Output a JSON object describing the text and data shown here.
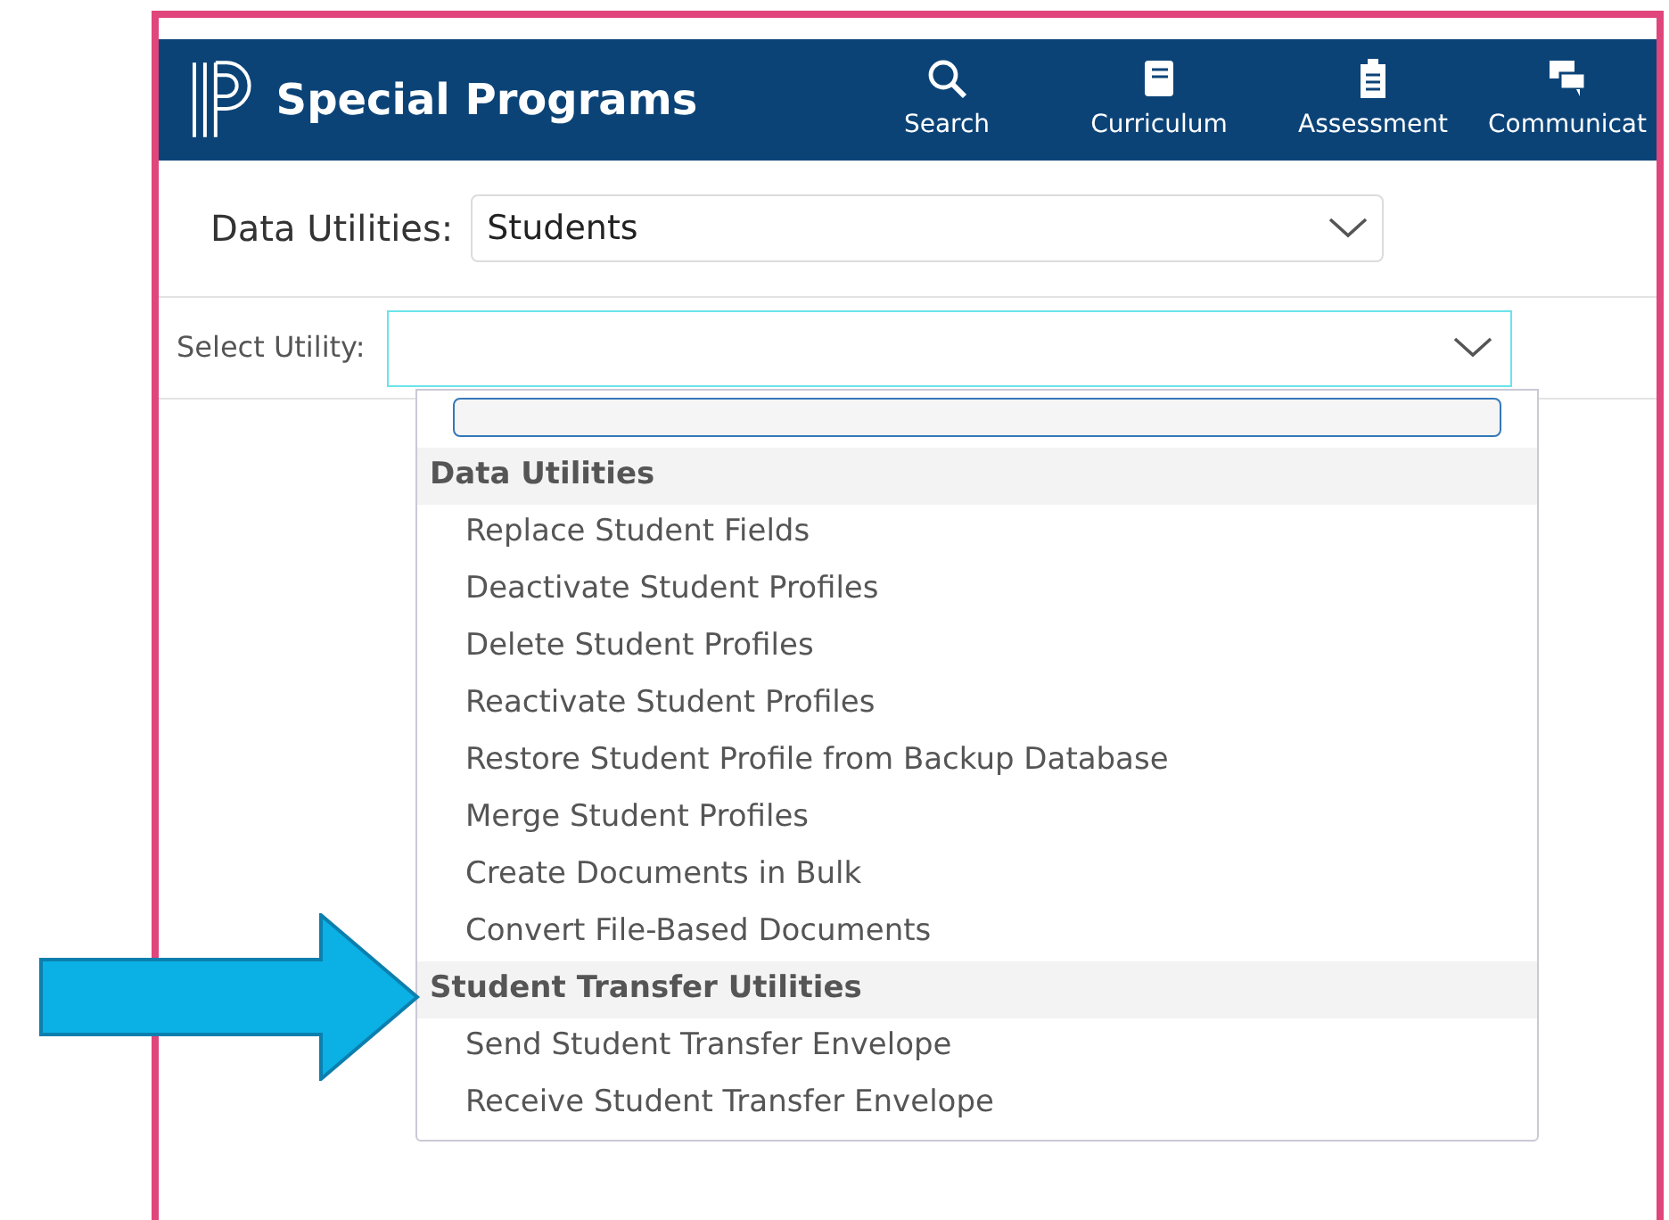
{
  "header": {
    "title": "Special Programs",
    "nav": [
      {
        "label": "Search",
        "kind": "search"
      },
      {
        "label": "Curriculum",
        "kind": "book"
      },
      {
        "label": "Assessment",
        "kind": "clipboard"
      },
      {
        "label": "Communicat",
        "kind": "chat"
      }
    ]
  },
  "data_utilities": {
    "label": "Data Utilities:",
    "value": "Students"
  },
  "select_utility": {
    "label": "Select Utility:"
  },
  "dropdown": {
    "groups": [
      {
        "title": "Data Utilities",
        "items": [
          "Replace Student Fields",
          "Deactivate Student Profiles",
          "Delete Student Profiles",
          "Reactivate Student Profiles",
          "Restore Student Profile from Backup Database",
          "Merge Student Profiles",
          "Create Documents in Bulk",
          "Convert File-Based Documents"
        ]
      },
      {
        "title": "Student Transfer Utilities",
        "items": [
          "Send Student Transfer Envelope",
          "Receive Student Transfer Envelope"
        ]
      }
    ]
  }
}
